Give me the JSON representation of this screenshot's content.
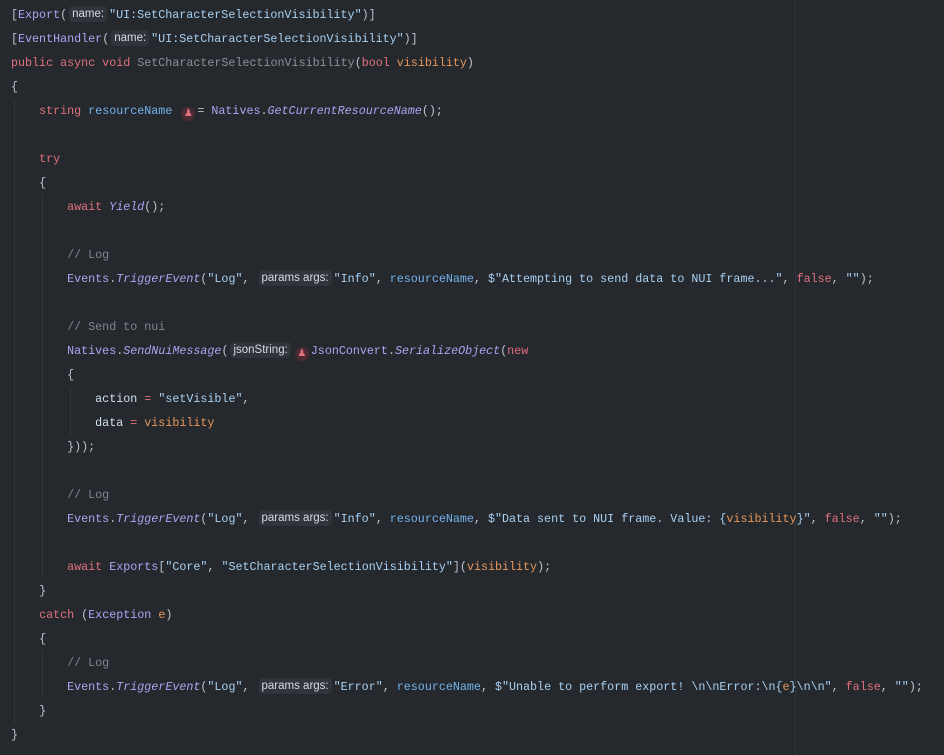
{
  "lines": [
    [
      [
        "punc",
        "["
      ],
      [
        "cls",
        "Export"
      ],
      [
        "punc",
        "("
      ],
      [
        "hint",
        "name:"
      ],
      [
        "str",
        "\"UI:SetCharacterSelectionVisibility\""
      ],
      [
        "punc",
        ")]"
      ]
    ],
    [
      [
        "punc",
        "["
      ],
      [
        "cls",
        "EventHandler"
      ],
      [
        "punc",
        "("
      ],
      [
        "hint",
        "name:"
      ],
      [
        "str",
        "\"UI:SetCharacterSelectionVisibility\""
      ],
      [
        "punc",
        ")]"
      ]
    ],
    [
      [
        "kw",
        "public async void "
      ],
      [
        "decl",
        "SetCharacterSelectionVisibility"
      ],
      [
        "punc",
        "("
      ],
      [
        "kw",
        "bool "
      ],
      [
        "param",
        "visibility"
      ],
      [
        "punc",
        ")"
      ]
    ],
    [
      [
        "punc",
        "{"
      ]
    ],
    [
      [
        "sp",
        "    "
      ],
      [
        "kw",
        "string "
      ],
      [
        "local",
        "resourceName "
      ],
      [
        "icon",
        "♟"
      ],
      [
        "punc",
        "= "
      ],
      [
        "cls",
        "Natives"
      ],
      [
        "punc",
        "."
      ],
      [
        "meth",
        "GetCurrentResourceName"
      ],
      [
        "punc",
        "();"
      ]
    ],
    [],
    [
      [
        "sp",
        "    "
      ],
      [
        "kw",
        "try"
      ]
    ],
    [
      [
        "sp",
        "    "
      ],
      [
        "punc",
        "{"
      ]
    ],
    [
      [
        "sp",
        "        "
      ],
      [
        "kw",
        "await "
      ],
      [
        "meth",
        "Yield"
      ],
      [
        "punc",
        "();"
      ]
    ],
    [],
    [
      [
        "sp",
        "        "
      ],
      [
        "cmt",
        "// Log"
      ]
    ],
    [
      [
        "sp",
        "        "
      ],
      [
        "cls",
        "Events"
      ],
      [
        "punc",
        "."
      ],
      [
        "meth",
        "TriggerEvent"
      ],
      [
        "punc",
        "("
      ],
      [
        "str",
        "\"Log\""
      ],
      [
        "punc",
        ", "
      ],
      [
        "hint",
        "params args:"
      ],
      [
        "str",
        "\"Info\""
      ],
      [
        "punc",
        ", "
      ],
      [
        "local",
        "resourceName"
      ],
      [
        "punc",
        ", "
      ],
      [
        "str",
        "$\"Attempting to send data to NUI frame...\""
      ],
      [
        "punc",
        ", "
      ],
      [
        "kw",
        "false"
      ],
      [
        "punc",
        ", "
      ],
      [
        "str",
        "\"\""
      ],
      [
        "punc",
        ");"
      ]
    ],
    [],
    [
      [
        "sp",
        "        "
      ],
      [
        "cmt",
        "// Send to nui"
      ]
    ],
    [
      [
        "sp",
        "        "
      ],
      [
        "cls",
        "Natives"
      ],
      [
        "punc",
        "."
      ],
      [
        "meth",
        "SendNuiMessage"
      ],
      [
        "punc",
        "("
      ],
      [
        "hint",
        "jsonString:"
      ],
      [
        "icon",
        "♟"
      ],
      [
        "cls",
        "JsonConvert"
      ],
      [
        "punc",
        "."
      ],
      [
        "meth",
        "SerializeObject"
      ],
      [
        "punc",
        "("
      ],
      [
        "kw",
        "new"
      ]
    ],
    [
      [
        "sp",
        "        "
      ],
      [
        "punc",
        "{"
      ]
    ],
    [
      [
        "sp",
        "            "
      ],
      [
        "prop",
        "action "
      ],
      [
        "kw",
        "= "
      ],
      [
        "str",
        "\"setVisible\""
      ],
      [
        "punc",
        ","
      ]
    ],
    [
      [
        "sp",
        "            "
      ],
      [
        "prop",
        "data "
      ],
      [
        "kw",
        "= "
      ],
      [
        "param",
        "visibility"
      ]
    ],
    [
      [
        "sp",
        "        "
      ],
      [
        "punc",
        "}));"
      ]
    ],
    [],
    [
      [
        "sp",
        "        "
      ],
      [
        "cmt",
        "// Log"
      ]
    ],
    [
      [
        "sp",
        "        "
      ],
      [
        "cls",
        "Events"
      ],
      [
        "punc",
        "."
      ],
      [
        "meth",
        "TriggerEvent"
      ],
      [
        "punc",
        "("
      ],
      [
        "str",
        "\"Log\""
      ],
      [
        "punc",
        ", "
      ],
      [
        "hint",
        "params args:"
      ],
      [
        "str",
        "\"Info\""
      ],
      [
        "punc",
        ", "
      ],
      [
        "local",
        "resourceName"
      ],
      [
        "punc",
        ", "
      ],
      [
        "str",
        "$\"Data sent to NUI frame. Value: {"
      ],
      [
        "param",
        "visibility"
      ],
      [
        "str",
        "}\""
      ],
      [
        "punc",
        ", "
      ],
      [
        "kw",
        "false"
      ],
      [
        "punc",
        ", "
      ],
      [
        "str",
        "\"\""
      ],
      [
        "punc",
        ");"
      ]
    ],
    [],
    [
      [
        "sp",
        "        "
      ],
      [
        "kw",
        "await "
      ],
      [
        "cls",
        "Exports"
      ],
      [
        "punc",
        "["
      ],
      [
        "str",
        "\"Core\""
      ],
      [
        "punc",
        ", "
      ],
      [
        "str",
        "\"SetCharacterSelectionVisibility\""
      ],
      [
        "punc",
        "]("
      ],
      [
        "param",
        "visibility"
      ],
      [
        "punc",
        ");"
      ]
    ],
    [
      [
        "sp",
        "    "
      ],
      [
        "punc",
        "}"
      ]
    ],
    [
      [
        "sp",
        "    "
      ],
      [
        "kw",
        "catch "
      ],
      [
        "punc",
        "("
      ],
      [
        "cls",
        "Exception "
      ],
      [
        "param",
        "e"
      ],
      [
        "punc",
        ")"
      ]
    ],
    [
      [
        "sp",
        "    "
      ],
      [
        "punc",
        "{"
      ]
    ],
    [
      [
        "sp",
        "        "
      ],
      [
        "cmt",
        "// Log"
      ]
    ],
    [
      [
        "sp",
        "        "
      ],
      [
        "cls",
        "Events"
      ],
      [
        "punc",
        "."
      ],
      [
        "meth",
        "TriggerEvent"
      ],
      [
        "punc",
        "("
      ],
      [
        "str",
        "\"Log\""
      ],
      [
        "punc",
        ", "
      ],
      [
        "hint",
        "params args:"
      ],
      [
        "str",
        "\"Error\""
      ],
      [
        "punc",
        ", "
      ],
      [
        "local",
        "resourceName"
      ],
      [
        "punc",
        ", "
      ],
      [
        "str",
        "$\"Unable to perform export! \\n\\nError:\\n{"
      ],
      [
        "param",
        "e"
      ],
      [
        "str",
        "}\\n\\n\""
      ],
      [
        "punc",
        ", "
      ],
      [
        "kw",
        "false"
      ],
      [
        "punc",
        ", "
      ],
      [
        "str",
        "\"\""
      ],
      [
        "punc",
        ");"
      ]
    ],
    [
      [
        "sp",
        "    "
      ],
      [
        "punc",
        "}"
      ]
    ],
    [
      [
        "punc",
        "}"
      ]
    ]
  ],
  "colors": {
    "background": "#25292e",
    "keyword": "#e0707c",
    "class": "#aaa6f2",
    "string": "#a9d0f2",
    "parameter": "#e8955a",
    "comment": "#7f848e"
  }
}
